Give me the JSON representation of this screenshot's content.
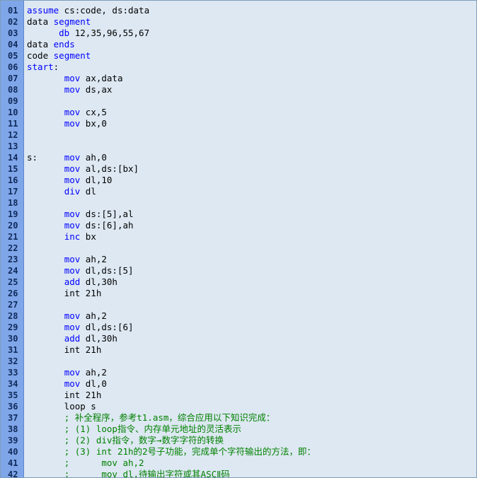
{
  "editor": {
    "colors": {
      "background": "#dde8f2",
      "gutter": "#7fa6e8",
      "keyword": "#0000ff",
      "comment": "#008000",
      "text": "#000000",
      "line_number": "#102a5c"
    },
    "lines": [
      {
        "num": "01",
        "tokens": [
          {
            "t": "assume",
            "c": "kw"
          },
          {
            "t": " cs:code, ds:data",
            "c": ""
          }
        ]
      },
      {
        "num": "02",
        "tokens": [
          {
            "t": "data ",
            "c": ""
          },
          {
            "t": "segment",
            "c": "kw"
          }
        ]
      },
      {
        "num": "03",
        "tokens": [
          {
            "t": "      ",
            "c": ""
          },
          {
            "t": "db",
            "c": "kw"
          },
          {
            "t": " 12,35,96,55,67",
            "c": ""
          }
        ]
      },
      {
        "num": "04",
        "tokens": [
          {
            "t": "data ",
            "c": ""
          },
          {
            "t": "ends",
            "c": "kw"
          }
        ]
      },
      {
        "num": "05",
        "tokens": [
          {
            "t": "code ",
            "c": ""
          },
          {
            "t": "segment",
            "c": "kw"
          }
        ]
      },
      {
        "num": "06",
        "tokens": [
          {
            "t": "start",
            "c": "kw"
          },
          {
            "t": ":",
            "c": ""
          }
        ]
      },
      {
        "num": "07",
        "tokens": [
          {
            "t": "       ",
            "c": ""
          },
          {
            "t": "mov",
            "c": "kw"
          },
          {
            "t": " ax,data",
            "c": ""
          }
        ]
      },
      {
        "num": "08",
        "tokens": [
          {
            "t": "       ",
            "c": ""
          },
          {
            "t": "mov",
            "c": "kw"
          },
          {
            "t": " ds,ax",
            "c": ""
          }
        ]
      },
      {
        "num": "09",
        "tokens": []
      },
      {
        "num": "10",
        "tokens": [
          {
            "t": "       ",
            "c": ""
          },
          {
            "t": "mov",
            "c": "kw"
          },
          {
            "t": " cx,5",
            "c": ""
          }
        ]
      },
      {
        "num": "11",
        "tokens": [
          {
            "t": "       ",
            "c": ""
          },
          {
            "t": "mov",
            "c": "kw"
          },
          {
            "t": " bx,0",
            "c": ""
          }
        ]
      },
      {
        "num": "12",
        "tokens": []
      },
      {
        "num": "13",
        "tokens": []
      },
      {
        "num": "14",
        "tokens": [
          {
            "t": "s:     ",
            "c": ""
          },
          {
            "t": "mov",
            "c": "kw"
          },
          {
            "t": " ah,0",
            "c": ""
          }
        ]
      },
      {
        "num": "15",
        "tokens": [
          {
            "t": "       ",
            "c": ""
          },
          {
            "t": "mov",
            "c": "kw"
          },
          {
            "t": " al,ds:[bx]",
            "c": ""
          }
        ]
      },
      {
        "num": "16",
        "tokens": [
          {
            "t": "       ",
            "c": ""
          },
          {
            "t": "mov",
            "c": "kw"
          },
          {
            "t": " dl,10",
            "c": ""
          }
        ]
      },
      {
        "num": "17",
        "tokens": [
          {
            "t": "       ",
            "c": ""
          },
          {
            "t": "div",
            "c": "kw"
          },
          {
            "t": " dl",
            "c": ""
          }
        ]
      },
      {
        "num": "18",
        "tokens": []
      },
      {
        "num": "19",
        "tokens": [
          {
            "t": "       ",
            "c": ""
          },
          {
            "t": "mov",
            "c": "kw"
          },
          {
            "t": " ds:[5],al",
            "c": ""
          }
        ]
      },
      {
        "num": "20",
        "tokens": [
          {
            "t": "       ",
            "c": ""
          },
          {
            "t": "mov",
            "c": "kw"
          },
          {
            "t": " ds:[6],ah",
            "c": ""
          }
        ]
      },
      {
        "num": "21",
        "tokens": [
          {
            "t": "       ",
            "c": ""
          },
          {
            "t": "inc",
            "c": "kw"
          },
          {
            "t": " bx",
            "c": ""
          }
        ]
      },
      {
        "num": "22",
        "tokens": []
      },
      {
        "num": "23",
        "tokens": [
          {
            "t": "       ",
            "c": ""
          },
          {
            "t": "mov",
            "c": "kw"
          },
          {
            "t": " ah,2",
            "c": ""
          }
        ]
      },
      {
        "num": "24",
        "tokens": [
          {
            "t": "       ",
            "c": ""
          },
          {
            "t": "mov",
            "c": "kw"
          },
          {
            "t": " dl,ds:[5]",
            "c": ""
          }
        ]
      },
      {
        "num": "25",
        "tokens": [
          {
            "t": "       ",
            "c": ""
          },
          {
            "t": "add",
            "c": "kw"
          },
          {
            "t": " dl,30h",
            "c": ""
          }
        ]
      },
      {
        "num": "26",
        "tokens": [
          {
            "t": "       int 21h",
            "c": ""
          }
        ]
      },
      {
        "num": "27",
        "tokens": []
      },
      {
        "num": "28",
        "tokens": [
          {
            "t": "       ",
            "c": ""
          },
          {
            "t": "mov",
            "c": "kw"
          },
          {
            "t": " ah,2",
            "c": ""
          }
        ]
      },
      {
        "num": "29",
        "tokens": [
          {
            "t": "       ",
            "c": ""
          },
          {
            "t": "mov",
            "c": "kw"
          },
          {
            "t": " dl,ds:[6]",
            "c": ""
          }
        ]
      },
      {
        "num": "30",
        "tokens": [
          {
            "t": "       ",
            "c": ""
          },
          {
            "t": "add",
            "c": "kw"
          },
          {
            "t": " dl,30h",
            "c": ""
          }
        ]
      },
      {
        "num": "31",
        "tokens": [
          {
            "t": "       int 21h",
            "c": ""
          }
        ]
      },
      {
        "num": "32",
        "tokens": []
      },
      {
        "num": "33",
        "tokens": [
          {
            "t": "       ",
            "c": ""
          },
          {
            "t": "mov",
            "c": "kw"
          },
          {
            "t": " ah,2",
            "c": ""
          }
        ]
      },
      {
        "num": "34",
        "tokens": [
          {
            "t": "       ",
            "c": ""
          },
          {
            "t": "mov",
            "c": "kw"
          },
          {
            "t": " dl,0",
            "c": ""
          }
        ]
      },
      {
        "num": "35",
        "tokens": [
          {
            "t": "       int 21h",
            "c": ""
          }
        ]
      },
      {
        "num": "36",
        "tokens": [
          {
            "t": "       loop s",
            "c": ""
          }
        ]
      },
      {
        "num": "37",
        "tokens": [
          {
            "t": "       ",
            "c": ""
          },
          {
            "t": "; 补全程序，参考t1.asm，综合应用以下知识完成：",
            "c": "cm"
          }
        ]
      },
      {
        "num": "38",
        "tokens": [
          {
            "t": "       ",
            "c": ""
          },
          {
            "t": "; (1) loop指令、内存单元地址的灵活表示",
            "c": "cm"
          }
        ]
      },
      {
        "num": "39",
        "tokens": [
          {
            "t": "       ",
            "c": ""
          },
          {
            "t": "; (2) div指令，数字→数字字符的转换",
            "c": "cm"
          }
        ]
      },
      {
        "num": "40",
        "tokens": [
          {
            "t": "       ",
            "c": ""
          },
          {
            "t": "; (3) int 21h的2号子功能，完成单个字符输出的方法，即：",
            "c": "cm"
          }
        ]
      },
      {
        "num": "41",
        "tokens": [
          {
            "t": "       ",
            "c": ""
          },
          {
            "t": ";      mov ah,2",
            "c": "cm"
          }
        ]
      },
      {
        "num": "42",
        "tokens": [
          {
            "t": "       ",
            "c": ""
          },
          {
            "t": ";      mov dl,待输出字符或其ASCⅡ码",
            "c": "cm"
          }
        ]
      }
    ]
  }
}
